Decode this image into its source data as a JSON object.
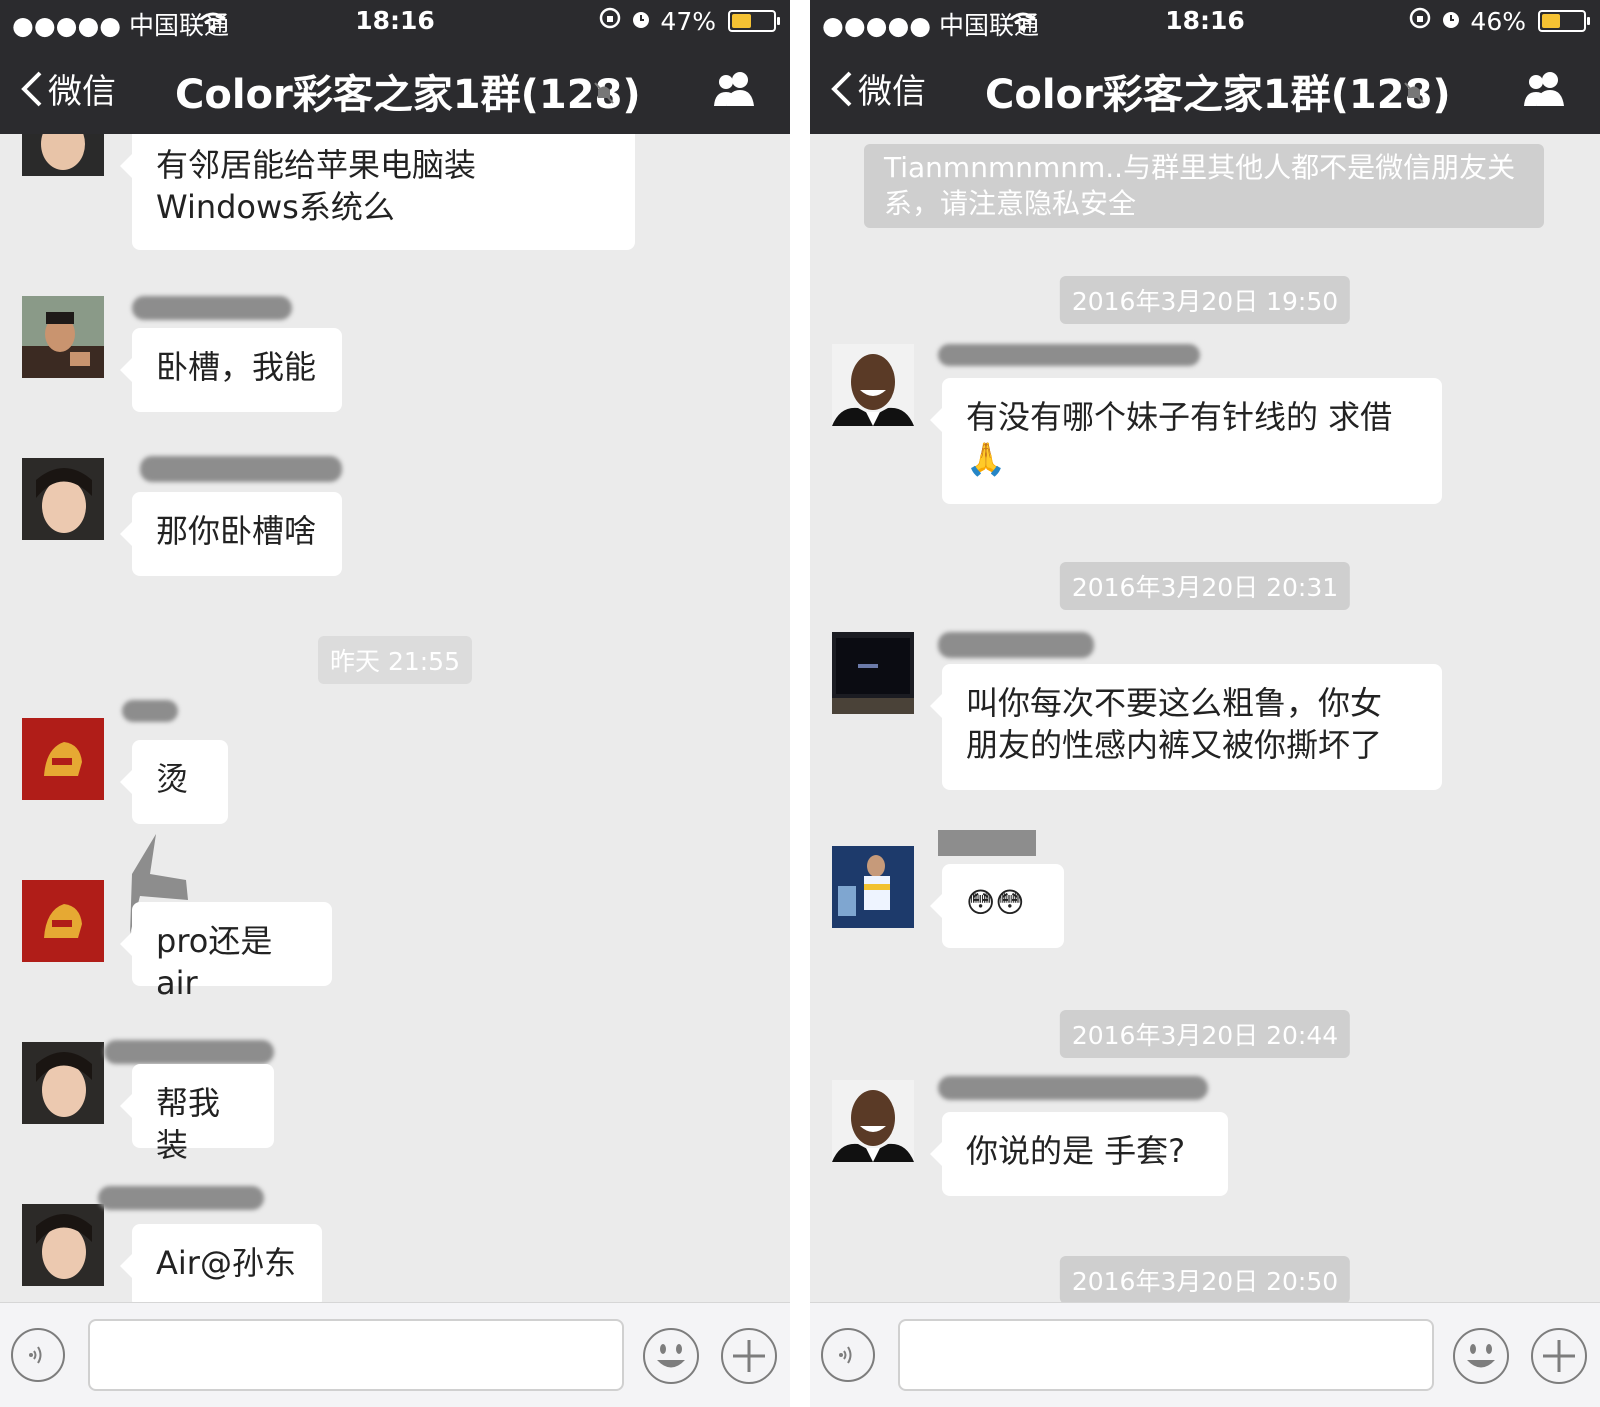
{
  "left": {
    "status": {
      "carrier": "●●●●● 中国联通",
      "time": "18:16",
      "battery": "47%"
    },
    "nav": {
      "back": "微信",
      "title": "Color彩客之家1群(128)"
    },
    "messages": [
      {
        "text1": "有邻居能给苹果电脑装",
        "text2": "Windows系统么"
      },
      {
        "text": "卧槽，我能"
      },
      {
        "text": "那你卧槽啥"
      },
      {
        "text": "烫"
      },
      {
        "text": "pro还是air"
      },
      {
        "text": "帮我装"
      },
      {
        "text": "Air@孙东"
      }
    ],
    "timestamp": "昨天 21:55"
  },
  "right": {
    "status": {
      "carrier": "●●●●● 中国联通",
      "time": "18:16",
      "battery": "46%"
    },
    "nav": {
      "back": "微信",
      "title": "Color彩客之家1群(128)"
    },
    "notice": "Tianmnmnmnm..与群里其他人都不是微信朋友关系，请注意隐私安全",
    "timestamps": [
      "2016年3月20日 19:50",
      "2016年3月20日 20:31",
      "2016年3月20日 20:44",
      "2016年3月20日 20:50"
    ],
    "messages": [
      {
        "text": "有没有哪个妹子有针线的 求借",
        "emoji": "🙏"
      },
      {
        "text1": "叫你每次不要这么粗鲁，你女",
        "text2": "朋友的性感内裤又被你撕坏了"
      },
      {
        "emoji": "😳😳"
      },
      {
        "text": "你说的是 手套?"
      }
    ]
  },
  "colors": {
    "bar": "#2b2b2e",
    "chat_bg": "#ebebeb",
    "battery": "#f5c233",
    "time_chip": "#cfcfcf"
  }
}
